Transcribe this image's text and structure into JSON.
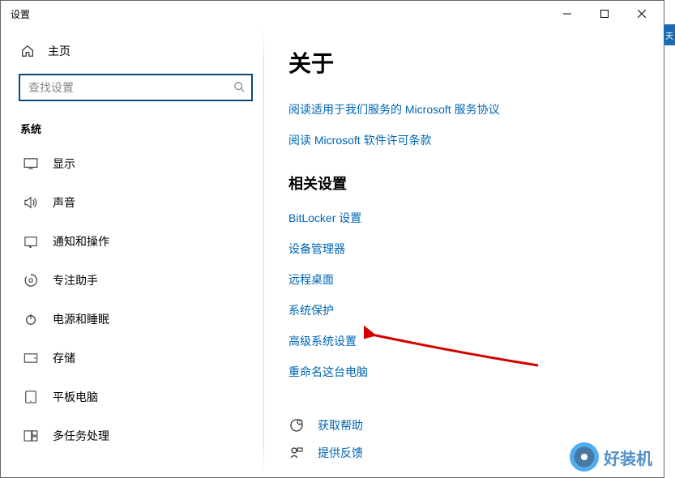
{
  "window": {
    "title": "设置"
  },
  "sidebar": {
    "home_label": "主页",
    "search_placeholder": "查找设置",
    "section_label": "系统",
    "items": [
      {
        "label": "显示"
      },
      {
        "label": "声音"
      },
      {
        "label": "通知和操作"
      },
      {
        "label": "专注助手"
      },
      {
        "label": "电源和睡眠"
      },
      {
        "label": "存储"
      },
      {
        "label": "平板电脑"
      },
      {
        "label": "多任务处理"
      }
    ]
  },
  "main": {
    "title": "关于",
    "top_links": [
      "阅读适用于我们服务的 Microsoft 服务协议",
      "阅读 Microsoft 软件许可条款"
    ],
    "related_heading": "相关设置",
    "related_links": [
      "BitLocker 设置",
      "设备管理器",
      "远程桌面",
      "系统保护",
      "高级系统设置",
      "重命名这台电脑"
    ],
    "help": {
      "get_help": "获取帮助",
      "feedback": "提供反馈"
    }
  },
  "watermark": "好装机"
}
